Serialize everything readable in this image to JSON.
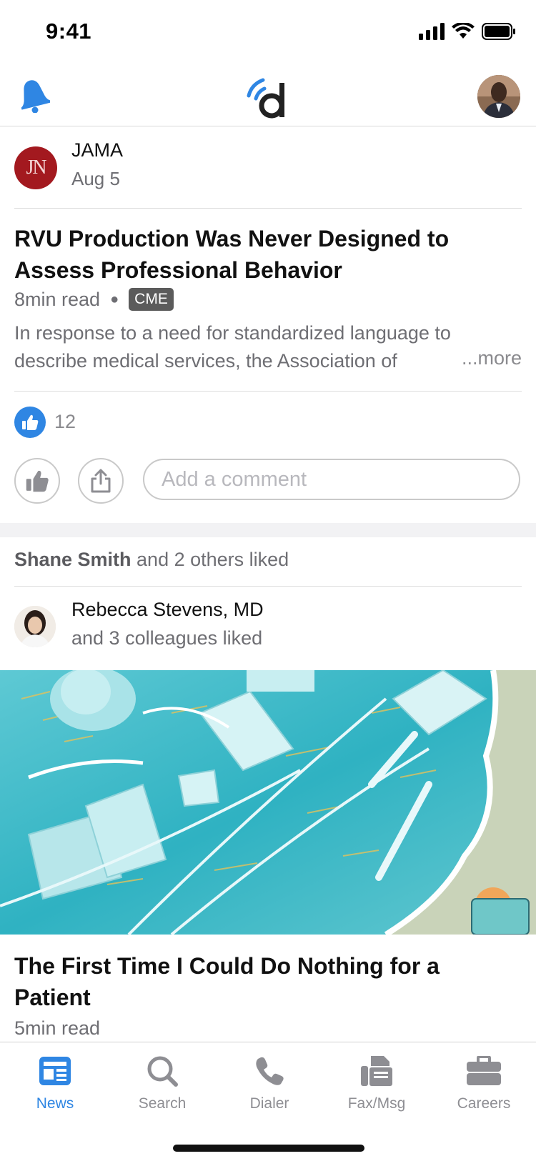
{
  "status_bar": {
    "time": "9:41"
  },
  "colors": {
    "accent": "#2f86e3",
    "jama_red": "#a3191f",
    "muted": "#6e6e73"
  },
  "header": {
    "left_icon": "bell-icon",
    "logo": "doximity-logo",
    "right_icon": "profile-avatar"
  },
  "post1": {
    "source_initials": "JN",
    "source_name": "JAMA",
    "date": "Aug 5",
    "title": "RVU Production Was Never Designed to Assess Professional Behavior",
    "read_time": "8min read",
    "badge": "CME",
    "excerpt": "In response to a need for standardized language to describe medical services, the Association of",
    "more_label": "...more",
    "likes": "12",
    "comment_placeholder": "Add a comment"
  },
  "post2": {
    "liked_name": "Shane Smith",
    "liked_rest": " and 2 others liked",
    "colleague_name": "Rebecca Stevens, MD",
    "colleague_sub": "and 3 colleagues liked",
    "title": "The First Time I Could Do Nothing for a Patient",
    "read_time": "5min read"
  },
  "tabs": [
    {
      "label": "News",
      "icon": "news-icon",
      "active": true
    },
    {
      "label": "Search",
      "icon": "search-icon",
      "active": false
    },
    {
      "label": "Dialer",
      "icon": "phone-icon",
      "active": false
    },
    {
      "label": "Fax/Msg",
      "icon": "fax-icon",
      "active": false
    },
    {
      "label": "Careers",
      "icon": "briefcase-icon",
      "active": false
    }
  ]
}
